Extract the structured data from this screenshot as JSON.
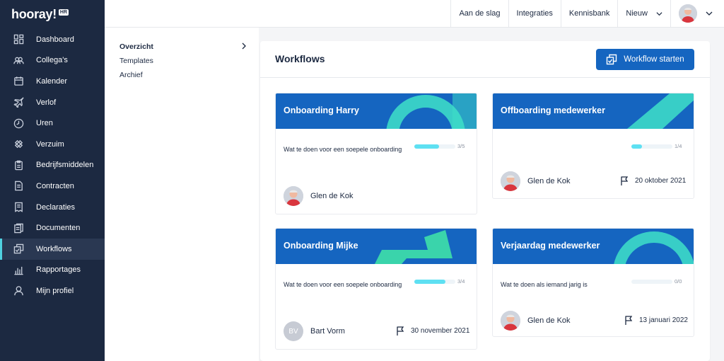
{
  "app": {
    "logo_text": "hooray!",
    "logo_badge": "HR"
  },
  "sidebar": {
    "items": [
      {
        "label": "Dashboard",
        "icon": "dashboard-icon"
      },
      {
        "label": "Collega's",
        "icon": "colleagues-icon"
      },
      {
        "label": "Kalender",
        "icon": "calendar-icon"
      },
      {
        "label": "Verlof",
        "icon": "plane-icon"
      },
      {
        "label": "Uren",
        "icon": "clock-icon"
      },
      {
        "label": "Verzuim",
        "icon": "bandage-icon"
      },
      {
        "label": "Bedrijfsmiddelen",
        "icon": "clipboard-icon"
      },
      {
        "label": "Contracten",
        "icon": "document-icon"
      },
      {
        "label": "Declaraties",
        "icon": "receipt-icon"
      },
      {
        "label": "Documenten",
        "icon": "documents-icon"
      },
      {
        "label": "Workflows",
        "icon": "workflow-icon",
        "active": true
      },
      {
        "label": "Rapportages",
        "icon": "chart-icon"
      },
      {
        "label": "Mijn profiel",
        "icon": "user-icon"
      }
    ]
  },
  "topbar": {
    "links": [
      "Aan de slag",
      "Integraties",
      "Kennisbank"
    ],
    "new_label": "Nieuw"
  },
  "subnav": {
    "items": [
      "Overzicht",
      "Templates",
      "Archief"
    ]
  },
  "main": {
    "title": "Workflows",
    "start_button": "Workflow starten",
    "cards": [
      {
        "title": "Onboarding Harry",
        "description": "Wat te doen voor een soepele onboarding",
        "progress": 0.6,
        "count": "3/5",
        "person": "Glen de Kok",
        "date": ""
      },
      {
        "title": "Offboarding medewerker",
        "description": "",
        "progress": 0.25,
        "count": "1/4",
        "person": "Glen de Kok",
        "date": "20 oktober 2021"
      },
      {
        "title": "Onboarding Mijke",
        "description": "Wat te doen voor een soepele onboarding",
        "progress": 0.75,
        "count": "3/4",
        "person": "Bart Vorm",
        "person_initials": "BV",
        "date": "30 november 2021"
      },
      {
        "title": "Verjaardag medewerker",
        "description": "Wat te doen als iemand jarig is",
        "progress": 0,
        "count": "0/0",
        "person": "Glen de Kok",
        "date": "13 januari 2022"
      }
    ]
  },
  "colors": {
    "sidebar": "#1c2941",
    "accent": "#1565c0",
    "progress": "#5ee0f2",
    "active_marker": "#4fd1e0"
  }
}
